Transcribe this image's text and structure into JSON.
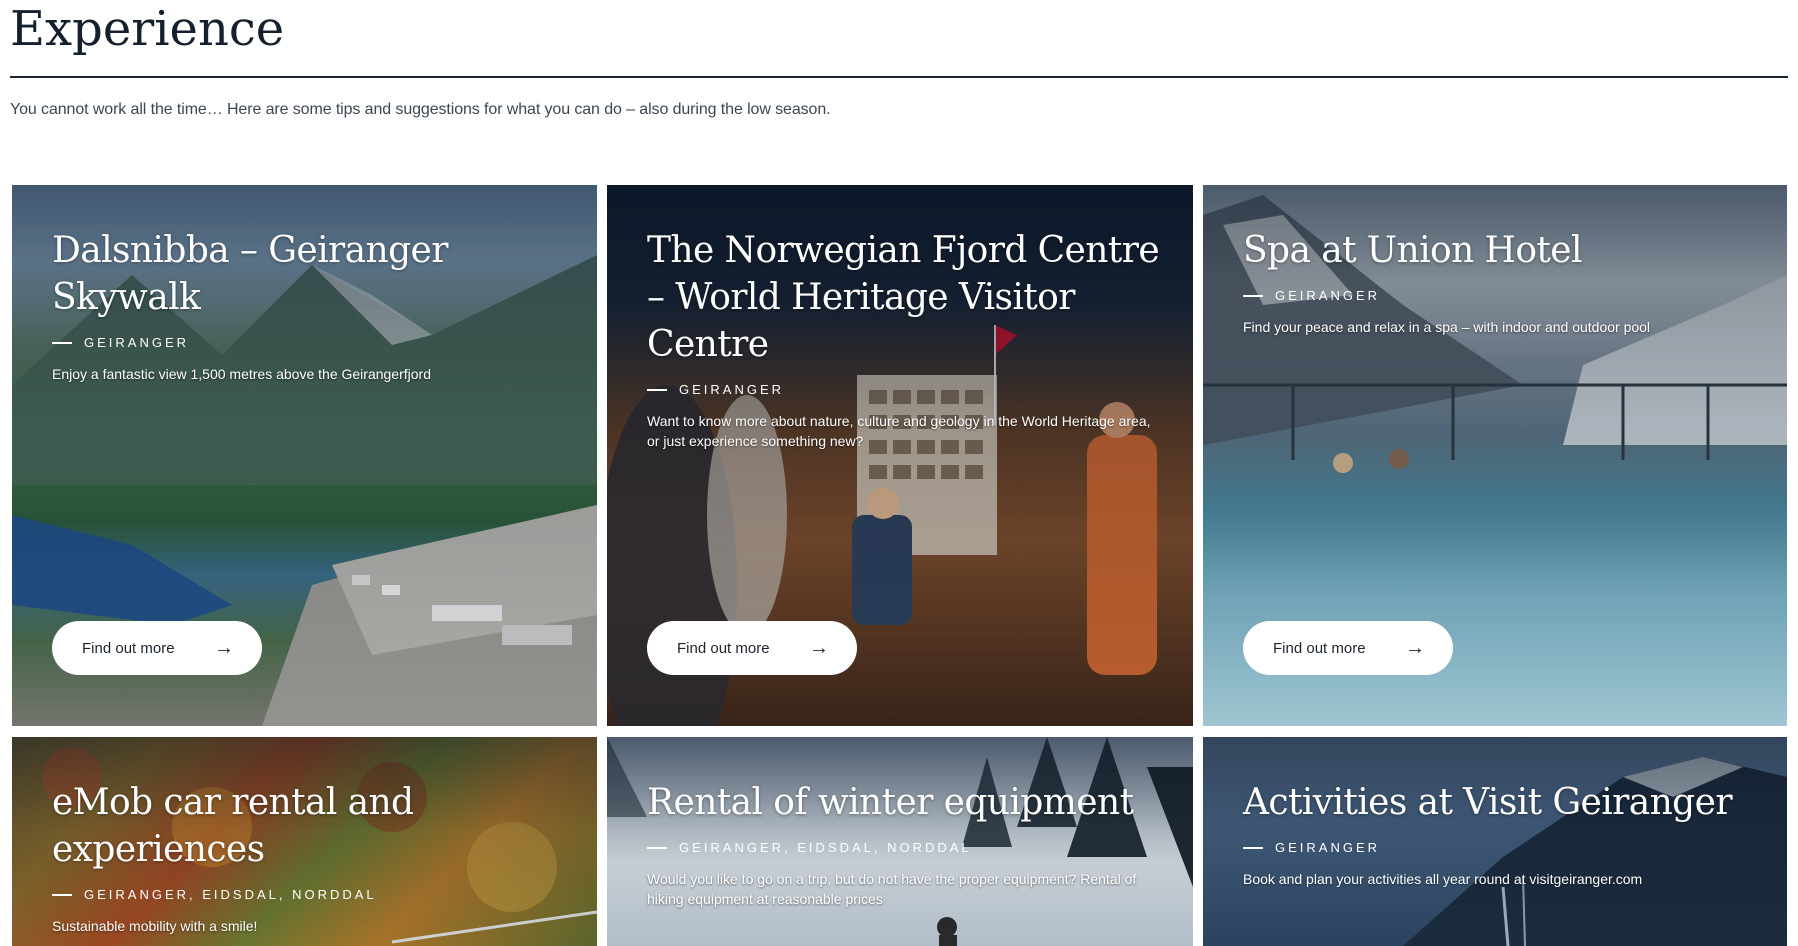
{
  "page": {
    "title": "Experience",
    "intro": "You cannot work all the time… Here are some tips and suggestions for what you can do – also during the low season."
  },
  "cards": [
    {
      "title": "Dalsnibba – Geiranger Skywalk",
      "location": "GEIRANGER",
      "description": "Enjoy a fantastic view 1,500 metres above the Geirangerfjord",
      "cta": "Find out more",
      "scene": "mountain-viewpoint"
    },
    {
      "title": "The Norwegian Fjord Centre – World Heritage Visitor Centre",
      "location": "GEIRANGER",
      "description": "Want to know more about nature, culture and geology in the World Heritage area, or just experience something new?",
      "cta": "Find out more",
      "scene": "museum-interior"
    },
    {
      "title": "Spa at Union Hotel",
      "location": "GEIRANGER",
      "description": "Find your peace and relax in a spa – with indoor and outdoor pool",
      "cta": "Find out more",
      "scene": "infinity-pool"
    },
    {
      "title": "eMob car rental and experiences",
      "location": "GEIRANGER, EIDSDAL, NORDDAL",
      "description": "Sustainable mobility with a smile!",
      "scene": "autumn-hillside"
    },
    {
      "title": "Rental of winter equipment",
      "location": "GEIRANGER, EIDSDAL, NORDDAL",
      "description": "Would you like to go on a trip, but do not have the proper equipment? Rental of hiking equipment at reasonable prices",
      "scene": "snowy-forest"
    },
    {
      "title": "Activities at Visit Geiranger",
      "location": "GEIRANGER",
      "description": "Book and plan your activities all year round at visitgeiranger.com",
      "scene": "fjord-cliff"
    }
  ],
  "icons": {
    "cta_arrow": "arrow-right-icon"
  },
  "colors": {
    "heading": "#14202e",
    "rule": "#1b2430",
    "button_bg": "#ffffff"
  }
}
